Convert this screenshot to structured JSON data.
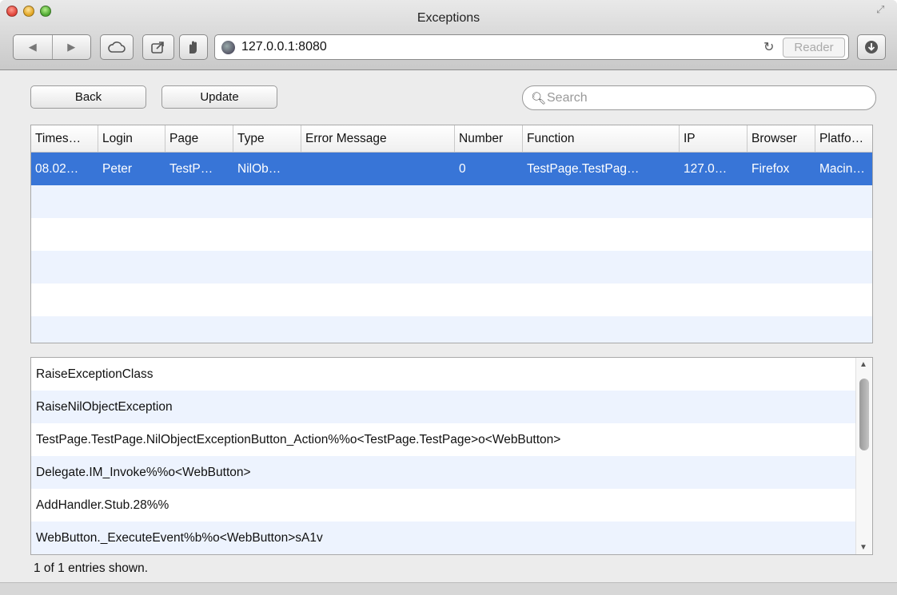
{
  "window": {
    "title": "Exceptions"
  },
  "toolbar": {
    "url": "127.0.0.1:8080",
    "reader_label": "Reader",
    "back_arrow": "◀",
    "forward_arrow": "▶"
  },
  "actions": {
    "back_label": "Back",
    "update_label": "Update"
  },
  "search": {
    "placeholder": "Search"
  },
  "table": {
    "columns": [
      "Times…",
      "Login",
      "Page",
      "Type",
      "Error Message",
      "Number",
      "Function",
      "IP",
      "Browser",
      "Platfo…"
    ],
    "rows": [
      [
        "08.02…",
        "Peter",
        "TestP…",
        "NilOb…",
        "",
        "0",
        "TestPage.TestPag…",
        "127.0…",
        "Firefox",
        "Macin…"
      ]
    ]
  },
  "stack": {
    "items": [
      "RaiseExceptionClass",
      "RaiseNilObjectException",
      "TestPage.TestPage.NilObjectExceptionButton_Action%%o<TestPage.TestPage>o<WebButton>",
      "Delegate.IM_Invoke%%o<WebButton>",
      "AddHandler.Stub.28%%",
      "WebButton._ExecuteEvent%b%o<WebButton>sA1v"
    ]
  },
  "status": {
    "text": "1 of 1 entries shown."
  },
  "colors": {
    "selection": "#3875d7",
    "alt_row": "#edf3fe"
  },
  "icons": [
    "close-button",
    "minimize-button",
    "zoom-button",
    "fullscreen-icon",
    "cloud-icon",
    "share-icon",
    "hand-icon",
    "globe-icon",
    "reload-icon",
    "download-icon",
    "search-icon"
  ]
}
